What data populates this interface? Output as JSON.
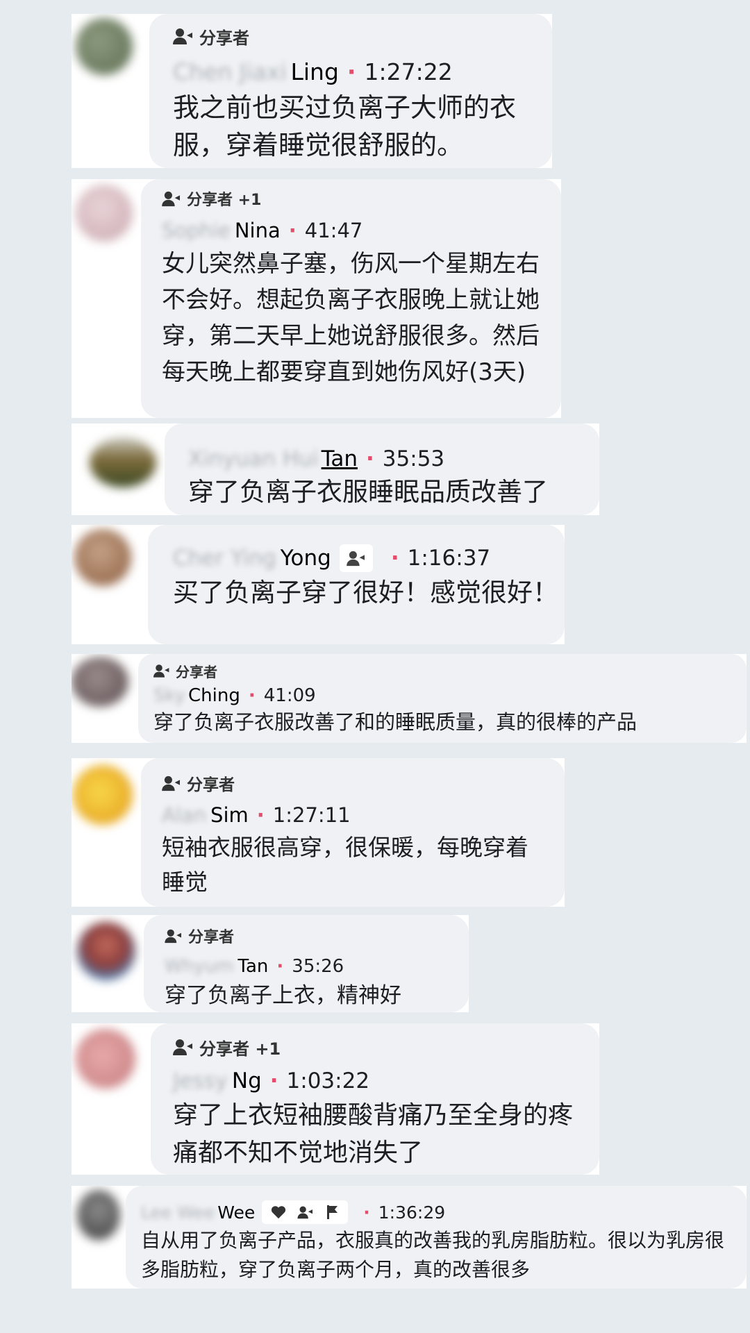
{
  "comments": [
    {
      "badge": "分享者",
      "name_blurred": "Chen Jiaxi",
      "name": "Ling",
      "time": "1:27:22",
      "text": "我之前也买过负离子大师的衣服，穿着睡觉很舒服的。"
    },
    {
      "badge": "分享者 +1",
      "name_blurred": "Sophie",
      "name": "Nina",
      "time": "41:47",
      "text": "女儿突然鼻子塞，伤风一个星期左右不会好。想起负离子衣服晚上就让她穿，第二天早上她说舒服很多。然后每天晚上都要穿直到她伤风好(3天)"
    },
    {
      "badge": "",
      "name_blurred": "Xinyuan Hui",
      "name": "Tan",
      "time": "35:53",
      "text": "穿了负离子衣服睡眠品质改善了"
    },
    {
      "badge": "",
      "name_blurred": "Cher Ying",
      "name": "Yong",
      "time": "1:16:37",
      "text": "买了负离子穿了很好！感觉很好！"
    },
    {
      "badge": "分享者",
      "name_blurred": "Sky",
      "name": "Ching",
      "time": "41:09",
      "text": "穿了负离子衣服改善了和的睡眠质量，真的很棒的产品"
    },
    {
      "badge": "分享者",
      "name_blurred": "Alan",
      "name": "Sim",
      "time": "1:27:11",
      "text": "短袖衣服很高穿，很保暖，每晚穿着睡觉"
    },
    {
      "badge": "分享者",
      "name_blurred": "Whyum",
      "name": "Tan",
      "time": "35:26",
      "text": "穿了负离子上衣，精神好"
    },
    {
      "badge": "分享者 +1",
      "name_blurred": "Jessy",
      "name": "Ng",
      "time": "1:03:22",
      "text": "穿了上衣短袖腰酸背痛乃至全身的疼痛都不知不觉地消失了"
    },
    {
      "badge": "",
      "name_blurred": "Lee Wee",
      "name": "Wee",
      "time": "1:36:29",
      "text": "自从用了负离子产品，衣服真的改善我的乳房脂肪粒。很以为乳房很多脂肪粒，穿了负离子两个月，真的改善很多"
    }
  ]
}
